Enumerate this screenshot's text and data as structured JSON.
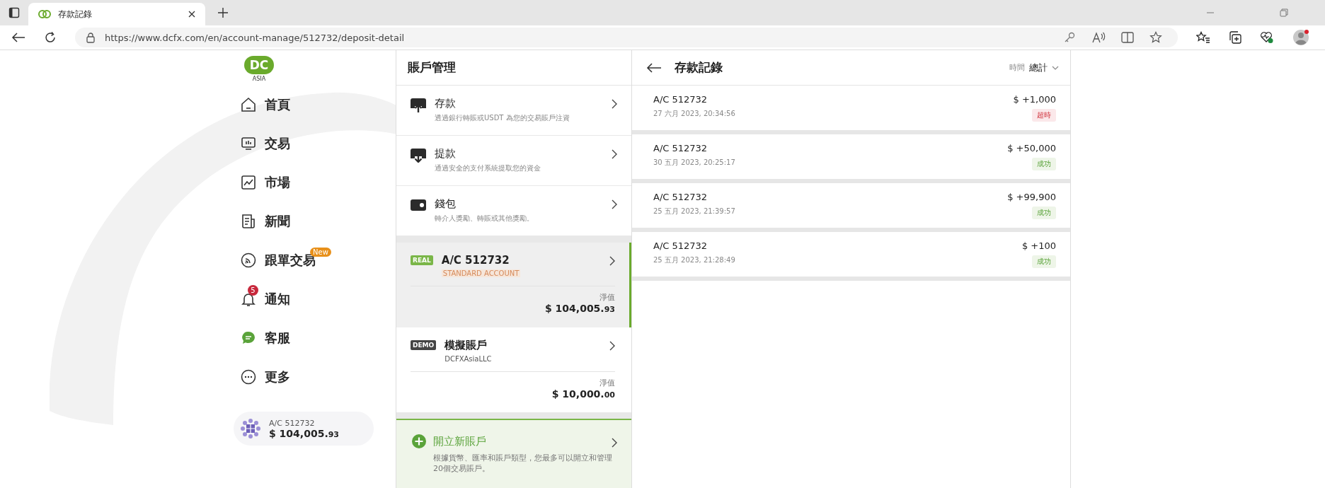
{
  "browser": {
    "tab": {
      "title": "存款記錄"
    },
    "url": "https://www.dcfx.com/en/account-manage/512732/deposit-detail"
  },
  "sidebar": {
    "logo": {
      "mark": "DC",
      "caption": "ASIA"
    },
    "nav": [
      {
        "label": "首頁"
      },
      {
        "label": "交易"
      },
      {
        "label": "市場"
      },
      {
        "label": "新聞"
      },
      {
        "label": "跟單交易",
        "tag": "New"
      },
      {
        "label": "通知",
        "count": "5"
      },
      {
        "label": "客服"
      },
      {
        "label": "更多"
      }
    ],
    "account": {
      "number": "A/C 512732",
      "balance": "$ 104,005.",
      "cents": "93"
    }
  },
  "account_management": {
    "title": "賬戶管理",
    "actions": [
      {
        "title": "存款",
        "description": "透過銀行轉賬或USDT 為您的交易賬戶注資"
      },
      {
        "title": "提款",
        "description": "通過安全的支付系統提取您的資金"
      },
      {
        "title": "錢包",
        "description": "轉介人獎勵、轉賬或其他獎勵。"
      }
    ],
    "accounts": [
      {
        "kind": "real",
        "tag": "REAL",
        "name": "A/C 512732",
        "subtitle": "STANDARD ACCOUNT",
        "equity_label": "淨值",
        "balance": "$ 104,005.",
        "cents": "93",
        "selected": true
      },
      {
        "kind": "demo",
        "tag": "DEMO",
        "name": "模擬賬戶",
        "subtitle": "DCFXAsiaLLC",
        "equity_label": "淨值",
        "balance": "$ 10,000.",
        "cents": "00",
        "selected": false
      }
    ],
    "open_account": {
      "title": "開立新賬戶",
      "description": "根據貨幣、匯率和賬戶類型，您最多可以開立和管理20個交易賬戶。"
    }
  },
  "deposit_records": {
    "title": "存款記錄",
    "filter": {
      "label": "時間",
      "value": "總計"
    },
    "records": [
      {
        "account": "A/C 512732",
        "datetime": "27 六月 2023, 20:34:56",
        "amount": "$ +1,000",
        "status": "超時",
        "kind": "timeout"
      },
      {
        "account": "A/C 512732",
        "datetime": "30 五月 2023, 20:25:17",
        "amount": "$ +50,000",
        "status": "成功",
        "kind": "success"
      },
      {
        "account": "A/C 512732",
        "datetime": "25 五月 2023, 21:39:57",
        "amount": "$ +99,900",
        "status": "成功",
        "kind": "success"
      },
      {
        "account": "A/C 512732",
        "datetime": "25 五月 2023, 21:28:49",
        "amount": "$ +100",
        "status": "成功",
        "kind": "success"
      }
    ]
  }
}
